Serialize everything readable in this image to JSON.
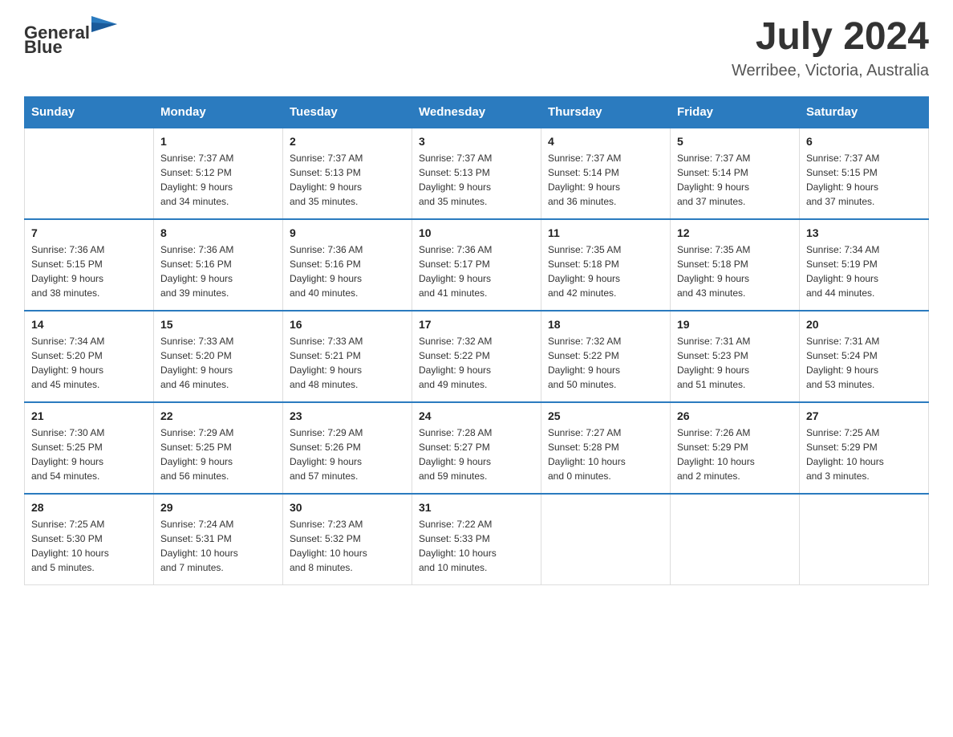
{
  "header": {
    "logo_general": "General",
    "logo_blue": "Blue",
    "month_year": "July 2024",
    "location": "Werribee, Victoria, Australia"
  },
  "days_of_week": [
    "Sunday",
    "Monday",
    "Tuesday",
    "Wednesday",
    "Thursday",
    "Friday",
    "Saturday"
  ],
  "weeks": [
    [
      {
        "day": "",
        "info": ""
      },
      {
        "day": "1",
        "info": "Sunrise: 7:37 AM\nSunset: 5:12 PM\nDaylight: 9 hours\nand 34 minutes."
      },
      {
        "day": "2",
        "info": "Sunrise: 7:37 AM\nSunset: 5:13 PM\nDaylight: 9 hours\nand 35 minutes."
      },
      {
        "day": "3",
        "info": "Sunrise: 7:37 AM\nSunset: 5:13 PM\nDaylight: 9 hours\nand 35 minutes."
      },
      {
        "day": "4",
        "info": "Sunrise: 7:37 AM\nSunset: 5:14 PM\nDaylight: 9 hours\nand 36 minutes."
      },
      {
        "day": "5",
        "info": "Sunrise: 7:37 AM\nSunset: 5:14 PM\nDaylight: 9 hours\nand 37 minutes."
      },
      {
        "day": "6",
        "info": "Sunrise: 7:37 AM\nSunset: 5:15 PM\nDaylight: 9 hours\nand 37 minutes."
      }
    ],
    [
      {
        "day": "7",
        "info": "Sunrise: 7:36 AM\nSunset: 5:15 PM\nDaylight: 9 hours\nand 38 minutes."
      },
      {
        "day": "8",
        "info": "Sunrise: 7:36 AM\nSunset: 5:16 PM\nDaylight: 9 hours\nand 39 minutes."
      },
      {
        "day": "9",
        "info": "Sunrise: 7:36 AM\nSunset: 5:16 PM\nDaylight: 9 hours\nand 40 minutes."
      },
      {
        "day": "10",
        "info": "Sunrise: 7:36 AM\nSunset: 5:17 PM\nDaylight: 9 hours\nand 41 minutes."
      },
      {
        "day": "11",
        "info": "Sunrise: 7:35 AM\nSunset: 5:18 PM\nDaylight: 9 hours\nand 42 minutes."
      },
      {
        "day": "12",
        "info": "Sunrise: 7:35 AM\nSunset: 5:18 PM\nDaylight: 9 hours\nand 43 minutes."
      },
      {
        "day": "13",
        "info": "Sunrise: 7:34 AM\nSunset: 5:19 PM\nDaylight: 9 hours\nand 44 minutes."
      }
    ],
    [
      {
        "day": "14",
        "info": "Sunrise: 7:34 AM\nSunset: 5:20 PM\nDaylight: 9 hours\nand 45 minutes."
      },
      {
        "day": "15",
        "info": "Sunrise: 7:33 AM\nSunset: 5:20 PM\nDaylight: 9 hours\nand 46 minutes."
      },
      {
        "day": "16",
        "info": "Sunrise: 7:33 AM\nSunset: 5:21 PM\nDaylight: 9 hours\nand 48 minutes."
      },
      {
        "day": "17",
        "info": "Sunrise: 7:32 AM\nSunset: 5:22 PM\nDaylight: 9 hours\nand 49 minutes."
      },
      {
        "day": "18",
        "info": "Sunrise: 7:32 AM\nSunset: 5:22 PM\nDaylight: 9 hours\nand 50 minutes."
      },
      {
        "day": "19",
        "info": "Sunrise: 7:31 AM\nSunset: 5:23 PM\nDaylight: 9 hours\nand 51 minutes."
      },
      {
        "day": "20",
        "info": "Sunrise: 7:31 AM\nSunset: 5:24 PM\nDaylight: 9 hours\nand 53 minutes."
      }
    ],
    [
      {
        "day": "21",
        "info": "Sunrise: 7:30 AM\nSunset: 5:25 PM\nDaylight: 9 hours\nand 54 minutes."
      },
      {
        "day": "22",
        "info": "Sunrise: 7:29 AM\nSunset: 5:25 PM\nDaylight: 9 hours\nand 56 minutes."
      },
      {
        "day": "23",
        "info": "Sunrise: 7:29 AM\nSunset: 5:26 PM\nDaylight: 9 hours\nand 57 minutes."
      },
      {
        "day": "24",
        "info": "Sunrise: 7:28 AM\nSunset: 5:27 PM\nDaylight: 9 hours\nand 59 minutes."
      },
      {
        "day": "25",
        "info": "Sunrise: 7:27 AM\nSunset: 5:28 PM\nDaylight: 10 hours\nand 0 minutes."
      },
      {
        "day": "26",
        "info": "Sunrise: 7:26 AM\nSunset: 5:29 PM\nDaylight: 10 hours\nand 2 minutes."
      },
      {
        "day": "27",
        "info": "Sunrise: 7:25 AM\nSunset: 5:29 PM\nDaylight: 10 hours\nand 3 minutes."
      }
    ],
    [
      {
        "day": "28",
        "info": "Sunrise: 7:25 AM\nSunset: 5:30 PM\nDaylight: 10 hours\nand 5 minutes."
      },
      {
        "day": "29",
        "info": "Sunrise: 7:24 AM\nSunset: 5:31 PM\nDaylight: 10 hours\nand 7 minutes."
      },
      {
        "day": "30",
        "info": "Sunrise: 7:23 AM\nSunset: 5:32 PM\nDaylight: 10 hours\nand 8 minutes."
      },
      {
        "day": "31",
        "info": "Sunrise: 7:22 AM\nSunset: 5:33 PM\nDaylight: 10 hours\nand 10 minutes."
      },
      {
        "day": "",
        "info": ""
      },
      {
        "day": "",
        "info": ""
      },
      {
        "day": "",
        "info": ""
      }
    ]
  ]
}
